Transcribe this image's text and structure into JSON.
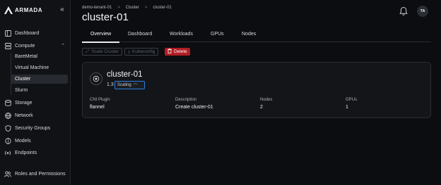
{
  "app": {
    "brand": "ARMADA",
    "collapse_icon": "double-chevron-left-icon"
  },
  "sidebar": {
    "items": [
      {
        "label": "Dashboard",
        "icon": "layout-icon"
      },
      {
        "label": "Compute",
        "icon": "server-icon"
      },
      {
        "label": "Storage",
        "icon": "database-icon"
      },
      {
        "label": "Network",
        "icon": "globe-icon"
      },
      {
        "label": "Security Groups",
        "icon": "shield-icon"
      },
      {
        "label": "Models",
        "icon": "models-icon"
      },
      {
        "label": "Endpoints",
        "icon": "endpoint-icon"
      },
      {
        "label": "Roles and Permissions",
        "icon": "users-icon"
      }
    ],
    "compute_sub": [
      "BareMetal",
      "Virtual Machine",
      "Cluster",
      "Slurm"
    ],
    "active_sub": "Cluster"
  },
  "header": {
    "breadcrumb": [
      "demo-tenant-01",
      "Cluster",
      "cluster-01"
    ],
    "title": "cluster-01",
    "avatar": "TA"
  },
  "tabs": [
    "Overview",
    "Dashboard",
    "Workloads",
    "GPUs",
    "Nodes"
  ],
  "active_tab": "Overview",
  "actions": {
    "scale": "Scale Cluster",
    "kubeconfig": "Kubeconfig",
    "delete": "Delete"
  },
  "card": {
    "name": "cluster-01",
    "version": "1.3",
    "status": "Scaling",
    "props": [
      {
        "label": "CNI Plugin",
        "value": "flannel"
      },
      {
        "label": "Description",
        "value": "Create cluster-01"
      },
      {
        "label": "Nodes",
        "value": "2"
      },
      {
        "label": "GPUs",
        "value": "1"
      }
    ]
  },
  "colors": {
    "accent_danger": "#b11d24",
    "highlight": "#2f7fe0",
    "background": "#0b0d10"
  }
}
